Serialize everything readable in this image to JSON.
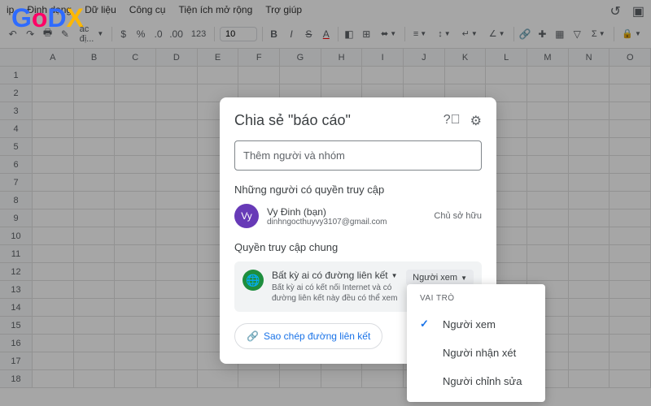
{
  "menubar": [
    "ip",
    "Định dạng",
    "Dữ liệu",
    "Công cụ",
    "Tiện ích mở rộng",
    "Trợ giúp"
  ],
  "toolbar": {
    "pct": "ác đị...",
    "font_size": "10",
    "font_label": "123"
  },
  "columns": [
    "A",
    "B",
    "C",
    "D",
    "E",
    "F",
    "G",
    "H",
    "I",
    "J",
    "K",
    "L",
    "M",
    "N",
    "O"
  ],
  "rows": [
    "1",
    "2",
    "3",
    "4",
    "5",
    "6"
  ],
  "modal": {
    "title": "Chia sẻ \"báo cáo\"",
    "placeholder": "Thêm người và nhóm",
    "people_label": "Những người có quyền truy cập",
    "user": {
      "initials": "Vy",
      "name": "Vy Đinh (bạn)",
      "email": "dinhngocthuyvy3107@gmail.com",
      "role": "Chủ sở hữu"
    },
    "general_label": "Quyền truy cập chung",
    "access_title": "Bất kỳ ai có đường liên kết",
    "access_desc": "Bất kỳ ai có kết nối Internet và có đường liên kết này đều có thể xem",
    "role_btn": "Người xem",
    "copy_btn": "Sao chép đường liên kết"
  },
  "dropdown": {
    "header": "VAI TRÒ",
    "items": [
      "Người xem",
      "Người nhận xét",
      "Người chỉnh sửa"
    ],
    "selected": 0
  }
}
